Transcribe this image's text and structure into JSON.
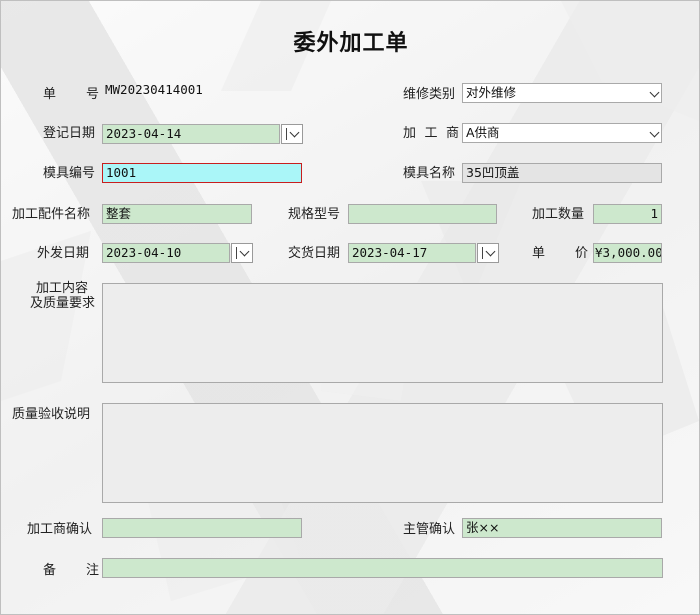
{
  "title": "委外加工单",
  "labels": {
    "order_no_a": "单",
    "order_no_b": "号",
    "repair_type": "维修类别",
    "register_date": "登记日期",
    "vendor_a": "加",
    "vendor_b": "工",
    "vendor_c": "商",
    "mold_no": "模具编号",
    "mold_name": "模具名称",
    "part_name": "加工配件名称",
    "spec": "规格型号",
    "qty": "加工数量",
    "send_date": "外发日期",
    "delivery_date": "交货日期",
    "price_a": "单",
    "price_b": "价",
    "content_line1": "加工内容",
    "content_line2": "及质量要求",
    "inspection": "质量验收说明",
    "vendor_confirm": "加工商确认",
    "manager_confirm": "主管确认",
    "note_a": "备",
    "note_b": "注"
  },
  "values": {
    "order_no": "MW20230414001",
    "repair_type": "对外维修",
    "register_date": "2023-04-14",
    "vendor": "A供商",
    "mold_no": "1001",
    "mold_name": "35凹顶盖",
    "part_name": "整套",
    "spec": "",
    "qty": "1",
    "send_date": "2023-04-10",
    "delivery_date": "2023-04-17",
    "price": "¥3,000.00",
    "content": "",
    "inspection": "",
    "vendor_confirm": "",
    "manager_confirm": "张××",
    "note": ""
  },
  "colors": {
    "field_green": "#cde8cd",
    "field_cyan": "#aaf6f8",
    "focus_border": "#c81e1e",
    "readonly_gray": "#e4e4e4"
  },
  "icons": {
    "dropdown": "chevron-down-icon",
    "date_picker": "date-dropdown-icon"
  }
}
